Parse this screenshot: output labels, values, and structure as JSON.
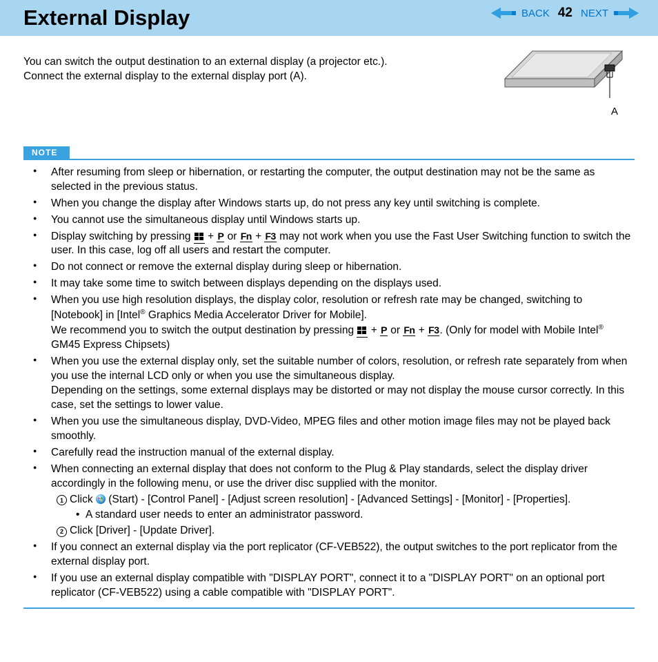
{
  "header": {
    "title": "External Display",
    "back": "BACK",
    "next": "NEXT",
    "page": "42"
  },
  "intro": {
    "line1": "You can switch the output destination to an external display (a projector etc.).",
    "line2": "Connect the external display to the external display port (A)."
  },
  "figure": {
    "label": "A"
  },
  "note_label": "NOTE",
  "notes": {
    "n1": "After resuming from sleep or hibernation, or restarting the computer, the output destination may not be the same as selected in the previous status.",
    "n2": "When you change the display after Windows starts up, do not press any key until switching is complete.",
    "n3": "You cannot use the simultaneous display until Windows starts up.",
    "n4a": "Display switching by pressing ",
    "n4b": " may not work when you use the Fast User Switching function to switch the user. In this case, log off all users and restart the computer.",
    "n5": "Do not connect or remove the external display during sleep or hibernation.",
    "n6": "It may take some time to switch between displays depending on the displays used.",
    "n7a": "When you use high resolution displays, the display color, resolution or refresh rate may be changed, switching to [Notebook] in  [Intel",
    "n7b": " Graphics Media Accelerator Driver for Mobile].",
    "n7c": "We recommend you to switch the output destination by pressing ",
    "n7d": ". (Only for model with Mobile Intel",
    "n7e": " GM45 Express Chipsets)",
    "n8a": "When you use the external display only, set the suitable number of colors, resolution, or refresh rate separately from when you use the internal LCD only or when you use the simultaneous display.",
    "n8b": "Depending on the settings, some external displays may be distorted or may not display the mouse cursor correctly. In this case, set the settings to lower value.",
    "n9": "When you use the simultaneous display, DVD-Video, MPEG files and other motion image files may not be played back smoothly.",
    "n10": "Carefully read the instruction manual of the external display.",
    "n11": "When connecting an external display that does not conform to the Plug & Play standards, select the display driver accordingly in the following menu, or use the driver disc supplied with the monitor.",
    "n11s1a": "Click ",
    "n11s1b": " (Start) - [Control Panel] - [Adjust screen resolution] - [Advanced Settings] - [Monitor] - [Properties].",
    "n11s1bullet": "A standard user needs to enter an administrator password.",
    "n11s2": "Click [Driver] - [Update Driver].",
    "n12": "If you connect an external display via the port replicator (CF-VEB522), the output switches to the port replicator from the external display port.",
    "n13": "If you use an external display compatible with \"DISPLAY PORT\", connect it to a \"DISPLAY PORT\" on an optional port replicator (CF-VEB522) using a cable compatible with \"DISPLAY PORT\"."
  },
  "keys": {
    "P": "P",
    "Fn": "Fn",
    "F3": "F3",
    "or": " or ",
    "plus": " + "
  }
}
